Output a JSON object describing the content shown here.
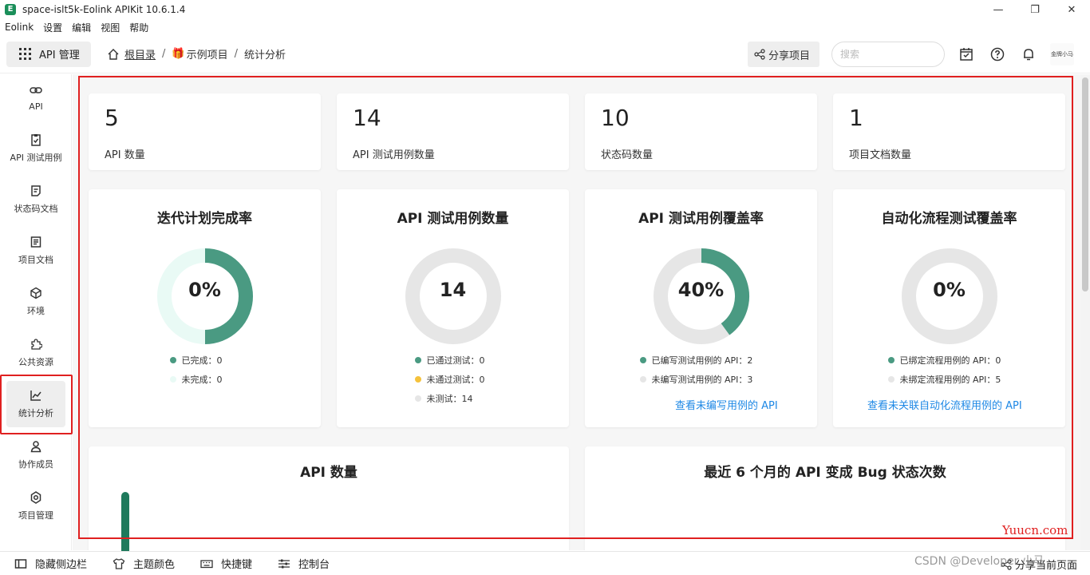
{
  "window": {
    "title": "space-islt5k-Eolink APIKit 10.6.1.4",
    "logo_glyph": "E",
    "minimize": "—",
    "maximize": "❐",
    "close": "✕"
  },
  "menu": [
    "Eolink",
    "设置",
    "编辑",
    "视图",
    "帮助"
  ],
  "topnav": {
    "module_label": "API 管理",
    "breadcrumb": {
      "root": "根目录",
      "sep1": "/",
      "project": "示例项目",
      "sep2": "/",
      "current": "统计分析"
    },
    "share_label": "分享项目",
    "search_placeholder": "搜索",
    "avatar_text": "金牌小马"
  },
  "sidebar": [
    {
      "label": "API",
      "icon": "link-icon"
    },
    {
      "label": "API 测试用例",
      "icon": "clipboard-check-icon"
    },
    {
      "label": "状态码文档",
      "icon": "code-doc-icon"
    },
    {
      "label": "项目文档",
      "icon": "document-icon"
    },
    {
      "label": "环境",
      "icon": "cube-icon"
    },
    {
      "label": "公共资源",
      "icon": "puzzle-icon"
    },
    {
      "label": "统计分析",
      "icon": "chart-icon",
      "active": true
    },
    {
      "label": "协作成员",
      "icon": "users-icon"
    },
    {
      "label": "项目管理",
      "icon": "settings-icon"
    }
  ],
  "sidebar_more": "···",
  "stats": [
    {
      "value": "5",
      "label": "API 数量"
    },
    {
      "value": "14",
      "label": "API 测试用例数量"
    },
    {
      "value": "10",
      "label": "状态码数量"
    },
    {
      "value": "1",
      "label": "项目文档数量"
    }
  ],
  "charts": {
    "iteration": {
      "title": "迭代计划完成率",
      "center": "0%",
      "legend": [
        {
          "text": "已完成：0",
          "color": "#4a9a82"
        },
        {
          "text": "未完成：0",
          "color": "#e9faf5"
        }
      ]
    },
    "cases": {
      "title": "API 测试用例数量",
      "center": "14",
      "legend": [
        {
          "text": "已通过测试：0",
          "color": "#4a9a82"
        },
        {
          "text": "未通过测试：0",
          "color": "#f5c23c"
        },
        {
          "text": "未测试：14",
          "color": "#e6e6e6"
        }
      ]
    },
    "coverage": {
      "title": "API 测试用例覆盖率",
      "center": "40%",
      "legend": [
        {
          "text": "已编写测试用例的 API：2",
          "color": "#4a9a82"
        },
        {
          "text": "未编写测试用例的 API：3",
          "color": "#e6e6e6"
        }
      ],
      "link": "查看未编写用例的 API"
    },
    "automation": {
      "title": "自动化流程测试覆盖率",
      "center": "0%",
      "legend": [
        {
          "text": "已绑定流程用例的 API：0",
          "color": "#4a9a82"
        },
        {
          "text": "未绑定流程用例的 API：5",
          "color": "#e6e6e6"
        }
      ],
      "link": "查看未关联自动化流程用例的 API"
    }
  },
  "bottom_sections": {
    "api_count_title": "API 数量",
    "bug_title": "最近 6 个月的 API 变成 Bug 状态次数"
  },
  "bottombar": {
    "items": [
      "隐藏侧边栏",
      "主题颜色",
      "快捷键",
      "控制台"
    ],
    "right": "分享当前页面"
  },
  "watermarks": {
    "yuucn": "Yuucn.com",
    "csdn": "CSDN @Developer 小马"
  },
  "colors": {
    "accent": "#4a9a82",
    "dark_green": "#1f7a5c",
    "highlight": "#e02020",
    "link": "#1e88e5"
  },
  "chart_data": [
    {
      "type": "pie",
      "title": "迭代计划完成率",
      "categories": [
        "已完成",
        "未完成"
      ],
      "values": [
        0,
        0
      ],
      "center_label": "0%"
    },
    {
      "type": "pie",
      "title": "API 测试用例数量",
      "categories": [
        "已通过测试",
        "未通过测试",
        "未测试"
      ],
      "values": [
        0,
        0,
        14
      ],
      "center_label": "14"
    },
    {
      "type": "pie",
      "title": "API 测试用例覆盖率",
      "categories": [
        "已编写测试用例的 API",
        "未编写测试用例的 API"
      ],
      "values": [
        2,
        3
      ],
      "center_label": "40%"
    },
    {
      "type": "pie",
      "title": "自动化流程测试覆盖率",
      "categories": [
        "已绑定流程用例的 API",
        "未绑定流程用例的 API"
      ],
      "values": [
        0,
        5
      ],
      "center_label": "0%"
    }
  ]
}
